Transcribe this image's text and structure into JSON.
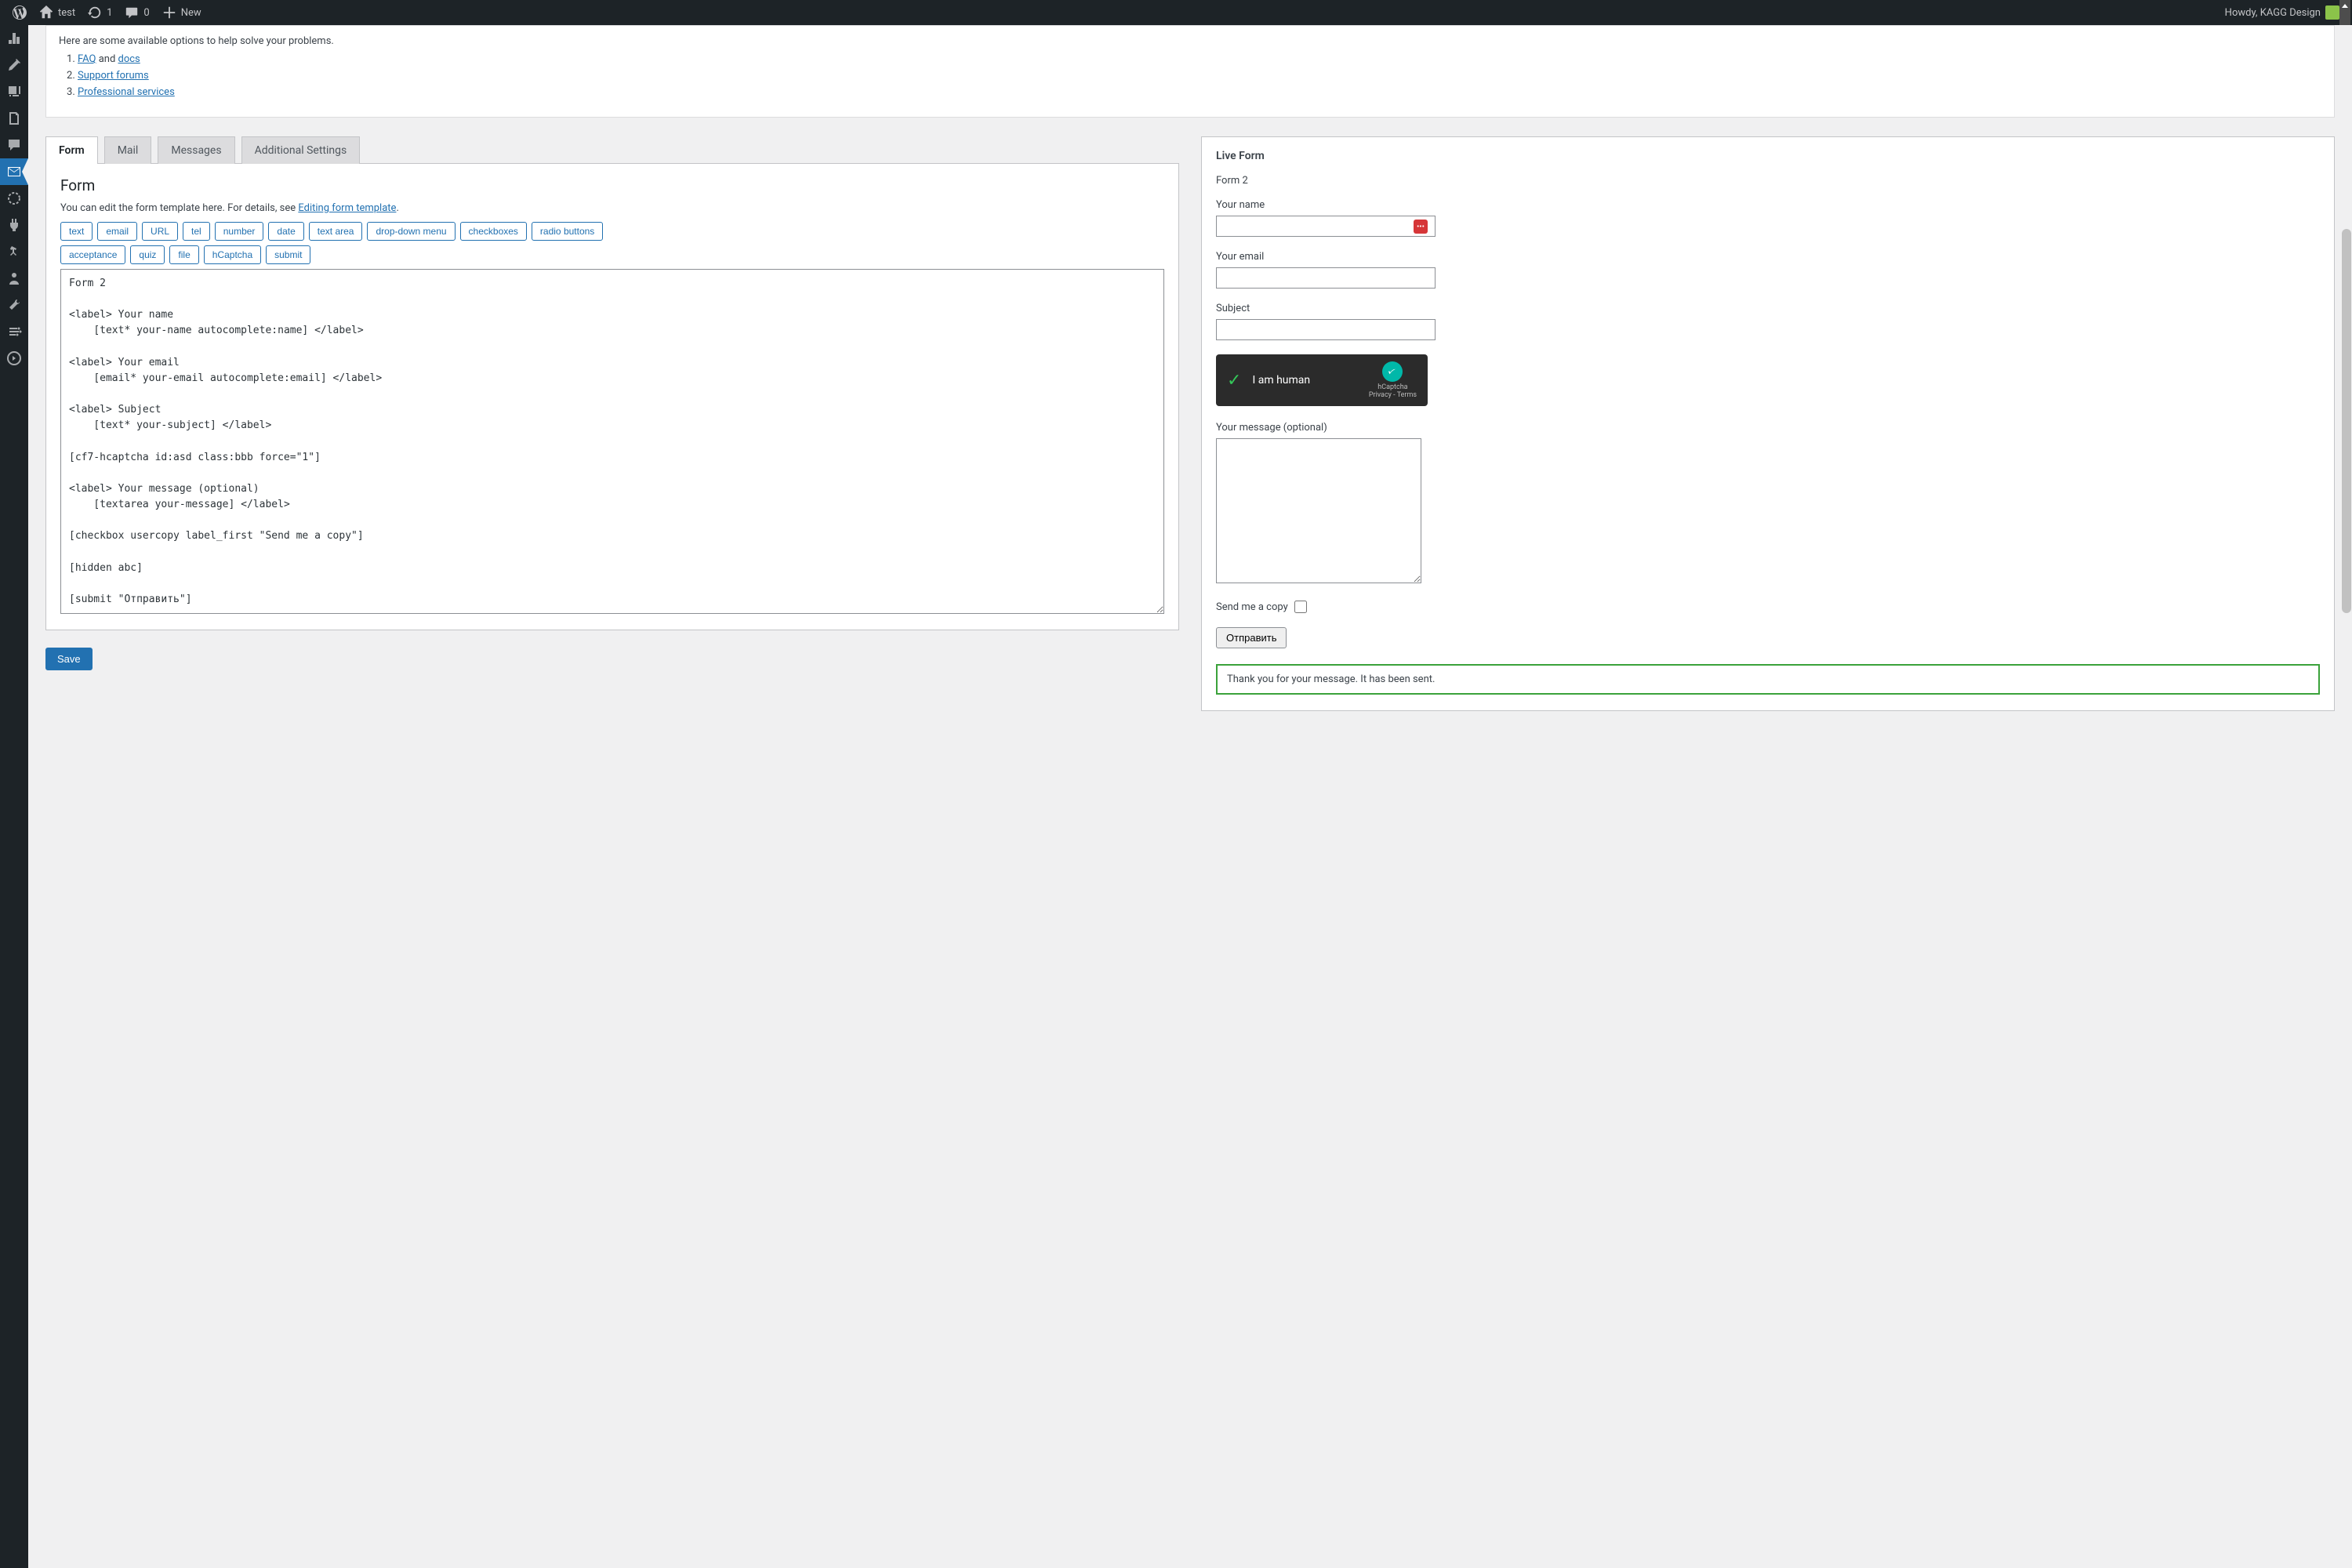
{
  "adminbar": {
    "site": "test",
    "updates": "1",
    "comments": "0",
    "new": "New",
    "greeting": "Howdy, KAGG Design"
  },
  "notice": {
    "intro": "Here are some available options to help solve your problems.",
    "items": [
      {
        "before": "",
        "link": "FAQ",
        "mid": " and ",
        "link2": "docs",
        "after": ""
      },
      {
        "before": "",
        "link": "Support forums",
        "mid": "",
        "link2": "",
        "after": ""
      },
      {
        "before": "",
        "link": "Professional services",
        "mid": "",
        "link2": "",
        "after": ""
      }
    ]
  },
  "tabs": [
    "Form",
    "Mail",
    "Messages",
    "Additional Settings"
  ],
  "form": {
    "heading": "Form",
    "desc_before": "You can edit the form template here. For details, see ",
    "desc_link": "Editing form template",
    "desc_after": ".",
    "tags_row1": [
      "text",
      "email",
      "URL",
      "tel",
      "number",
      "date",
      "text area",
      "drop-down menu",
      "checkboxes",
      "radio buttons"
    ],
    "tags_row2": [
      "acceptance",
      "quiz",
      "file",
      "hCaptcha",
      "submit"
    ],
    "textarea": "Form 2\n\n<label> Your name\n    [text* your-name autocomplete:name] </label>\n\n<label> Your email\n    [email* your-email autocomplete:email] </label>\n\n<label> Subject\n    [text* your-subject] </label>\n\n[cf7-hcaptcha id:asd class:bbb force=\"1\"]\n\n<label> Your message (optional)\n    [textarea your-message] </label>\n\n[checkbox usercopy label_first \"Send me a copy\"]\n\n[hidden abc]\n\n[submit \"Отправить\"]",
    "save": "Save"
  },
  "live": {
    "heading": "Live Form",
    "title": "Form 2",
    "your_name": "Your name",
    "your_email": "Your email",
    "subject": "Subject",
    "hcaptcha_label": "I am human",
    "hcaptcha_brand": "hCaptcha",
    "hcaptcha_links": "Privacy - Terms",
    "your_message": "Your message (optional)",
    "send_copy": "Send me a copy",
    "submit": "Отправить",
    "success": "Thank you for your message. It has been sent."
  }
}
